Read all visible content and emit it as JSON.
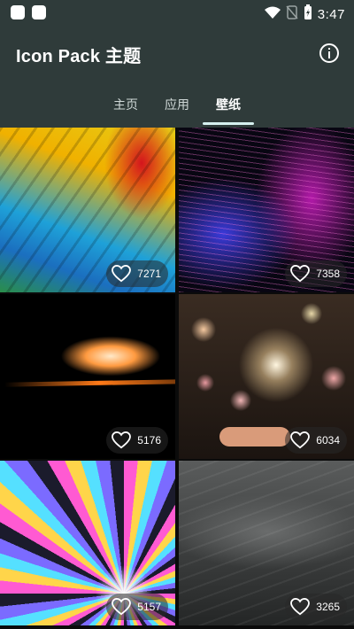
{
  "status_bar": {
    "time": "3:47",
    "icons": [
      "notification-square-icon",
      "notification-square-icon",
      "wifi-icon",
      "no-sim-icon",
      "battery-charging-icon"
    ]
  },
  "app_bar": {
    "title": "Icon Pack 主题",
    "info_icon": "info-icon"
  },
  "tabs": [
    {
      "label": "主页",
      "active": false
    },
    {
      "label": "应用",
      "active": false
    },
    {
      "label": "壁纸",
      "active": true
    }
  ],
  "wallpapers": [
    {
      "likes": "7271"
    },
    {
      "likes": "7358"
    },
    {
      "likes": "5176"
    },
    {
      "likes": "6034"
    },
    {
      "likes": "5157"
    },
    {
      "likes": "3265"
    }
  ],
  "colors": {
    "background": "#2f3b3a",
    "tab_indicator": "#d6f0ef",
    "text": "#ffffff"
  }
}
